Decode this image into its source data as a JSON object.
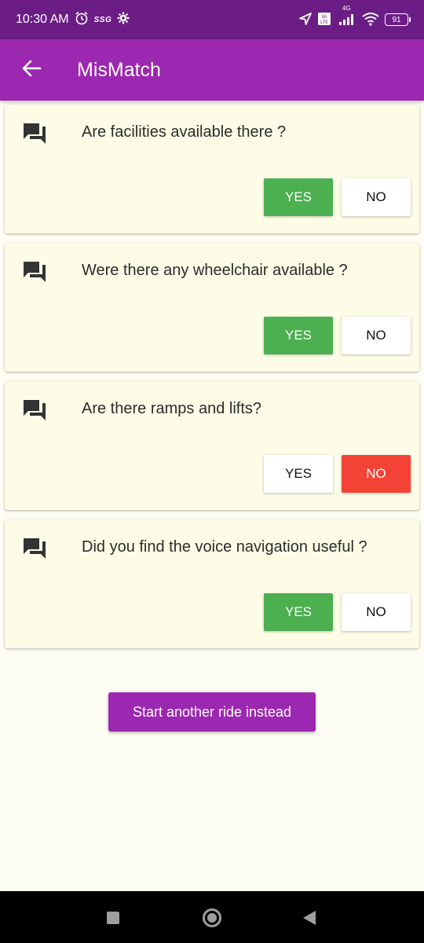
{
  "status_bar": {
    "time": "10:30 AM",
    "carrier_badge": "SSG",
    "network": "4G",
    "battery": "91"
  },
  "app_bar": {
    "title": "MisMatch"
  },
  "questions": [
    {
      "text": "Are facilities available there ?",
      "yes_label": "YES",
      "no_label": "NO",
      "selected": "yes"
    },
    {
      "text": "Were there any wheelchair available ?",
      "yes_label": "YES",
      "no_label": "NO",
      "selected": "yes"
    },
    {
      "text": "Are there ramps and lifts?",
      "yes_label": "YES",
      "no_label": "NO",
      "selected": "no"
    },
    {
      "text": "Did you find the voice navigation useful ?",
      "yes_label": "YES",
      "no_label": "NO",
      "selected": "yes"
    }
  ],
  "actions": {
    "start_another": "Start another ride instead"
  },
  "colors": {
    "primary": "#9C27B0",
    "status_bar": "#6B1D85",
    "yes_selected": "#4CAF50",
    "no_selected": "#F44336",
    "background": "#FDFDF3",
    "card": "#FCFCE7"
  }
}
